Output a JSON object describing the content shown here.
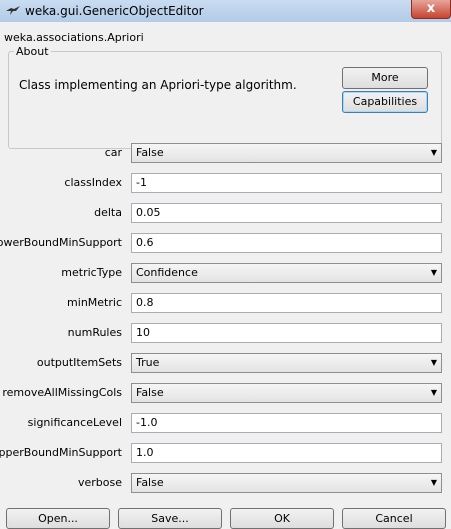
{
  "window": {
    "title": "weka.gui.GenericObjectEditor",
    "close_glyph": "x"
  },
  "class_name": "weka.associations.Apriori",
  "about": {
    "legend": "About",
    "description": "Class implementing an Apriori-type algorithm.",
    "more_label": "More",
    "capabilities_label": "Capabilities"
  },
  "params": [
    {
      "label": "car",
      "value": "False",
      "kind": "select"
    },
    {
      "label": "classIndex",
      "value": "-1",
      "kind": "text"
    },
    {
      "label": "delta",
      "value": "0.05",
      "kind": "text"
    },
    {
      "label": "lowerBoundMinSupport",
      "value": "0.6",
      "kind": "text"
    },
    {
      "label": "metricType",
      "value": "Confidence",
      "kind": "select"
    },
    {
      "label": "minMetric",
      "value": "0.8",
      "kind": "text"
    },
    {
      "label": "numRules",
      "value": "10",
      "kind": "text"
    },
    {
      "label": "outputItemSets",
      "value": "True",
      "kind": "select"
    },
    {
      "label": "removeAllMissingCols",
      "value": "False",
      "kind": "select"
    },
    {
      "label": "significanceLevel",
      "value": "-1.0",
      "kind": "text"
    },
    {
      "label": "upperBoundMinSupport",
      "value": "1.0",
      "kind": "text"
    },
    {
      "label": "verbose",
      "value": "False",
      "kind": "select"
    }
  ],
  "buttons": {
    "open": "Open...",
    "save": "Save...",
    "ok": "OK",
    "cancel": "Cancel"
  }
}
